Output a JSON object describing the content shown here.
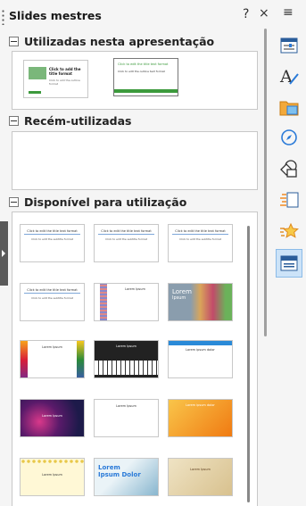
{
  "panel": {
    "title": "Slides mestres",
    "help": "?",
    "close": "×",
    "menu": "≡"
  },
  "sections": [
    {
      "label": "Utilizadas nesta apresentação"
    },
    {
      "label": "Recém-utilizadas"
    },
    {
      "label": "Disponível para utilização"
    }
  ],
  "used_thumbs": [
    {
      "title": "Click to add the title format",
      "sub": "Click to add the outline format",
      "style": "green-logo"
    },
    {
      "title": "Click to edit the title text format",
      "sub": "Click to edit the outline text format",
      "style": "green-bar"
    }
  ],
  "available_thumbs": [
    {
      "title": "Click to edit the title text format",
      "sub": "Click to edit the subtitle format",
      "style": "blank"
    },
    {
      "title": "Click to edit the title text format",
      "sub": "Click to edit the subtitle format",
      "style": "blank"
    },
    {
      "title": "Click to edit the title text format",
      "sub": "Click to edit the subtitle format",
      "style": "blank"
    },
    {
      "title": "Click to edit the title text format",
      "sub": "Click to edit the subtitle format",
      "style": "blank"
    },
    {
      "title": "Lorem Ipsum",
      "sub": "",
      "style": "dna"
    },
    {
      "title": "Lorem",
      "sub": "Ipsum",
      "style": "candy"
    },
    {
      "title": "Lorem Ipsum",
      "sub": "",
      "style": "colorful"
    },
    {
      "title": "Lorem Ipsum",
      "sub": "",
      "style": "piano"
    },
    {
      "title": "Lorem ipsum dolor",
      "sub": "",
      "style": "blue-top"
    },
    {
      "title": "Lorem Ipsum",
      "sub": "",
      "style": "bokeh"
    },
    {
      "title": "Lorem Ipsum",
      "sub": "",
      "style": "pencil"
    },
    {
      "title": "Lorem ipsum dolor",
      "sub": "",
      "style": "orange"
    },
    {
      "title": "Lorem Ipsum",
      "sub": "",
      "style": "yellow-dots"
    },
    {
      "title": "Lorem Ipsum Dolor",
      "sub": "",
      "style": "watercolor"
    },
    {
      "title": "Lorem Ipsum",
      "sub": "",
      "style": "parchment"
    }
  ],
  "sidebar_icons": [
    {
      "name": "properties-icon"
    },
    {
      "name": "styles-icon"
    },
    {
      "name": "gallery-icon"
    },
    {
      "name": "navigator-icon"
    },
    {
      "name": "shapes-icon"
    },
    {
      "name": "slide-transition-icon"
    },
    {
      "name": "animation-icon"
    },
    {
      "name": "master-slides-icon"
    }
  ],
  "colors": {
    "accent": "#2a7ad8",
    "green": "#3c9a3c"
  }
}
